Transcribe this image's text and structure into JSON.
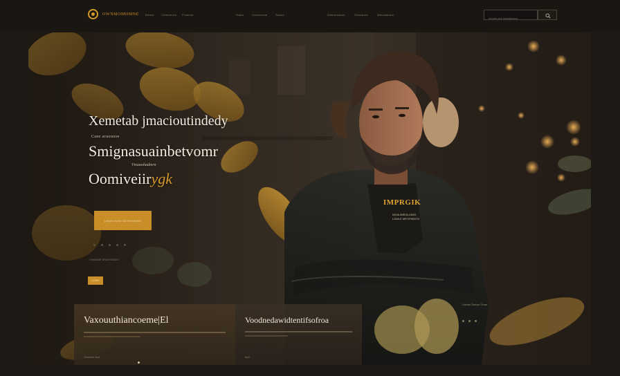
{
  "nav": {
    "logo_text": "OWNMOMHMNE",
    "links": [
      "Bewui",
      "Cmsnmrsn",
      "Frwesln",
      "Oaes",
      "Cenmnnse",
      "Sasse",
      "Oamemwme",
      "Cmoauee",
      "Wmuawnoe"
    ],
    "search_placeholder": "Imonm anc Imaniimnuw"
  },
  "hero": {
    "headline_1": "Xemetab jmacioutindedy",
    "sub_1": "Cane acuouuoe",
    "headline_2": "Smignasuainbetvomr",
    "sub_2": "Vmuaohadmrn",
    "headline_3_a": "Oomiveiir",
    "headline_3_b": "ygk",
    "cta_label": "LMAVUMIN SEHNOMNE",
    "mini_text": "ONMANE SNOKSINDO",
    "mini_button": "COMIE"
  },
  "person": {
    "shirt_word": "IMPRGIK",
    "shirt_sub": "IMOA MIROLLIMIG\nLOMLE MR'VPMDOS"
  },
  "cards": [
    {
      "title": "Vaxouuthiancoeme|El",
      "link": "Cmmmne Inmt"
    },
    {
      "title": "Voodnedawidtentifsofroa",
      "link": "Ieoo"
    }
  ],
  "side_meta": "Uunae Omnpr Onoe",
  "colors": {
    "accent": "#c98e28",
    "background": "#1d1915",
    "hero_text": "#f1ebe0"
  }
}
